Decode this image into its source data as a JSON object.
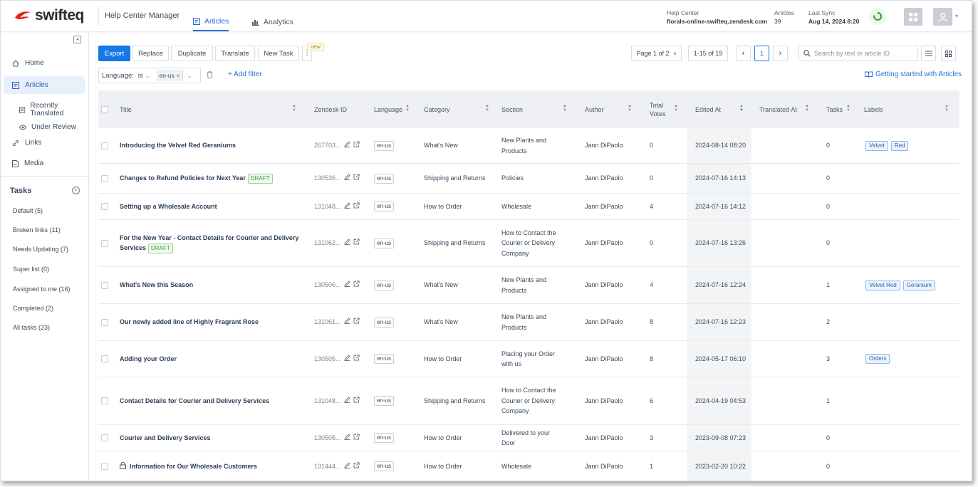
{
  "brand": {
    "name": "swifteq",
    "app_title": "Help Center Manager"
  },
  "nav": {
    "articles": "Articles",
    "analytics": "Analytics"
  },
  "header": {
    "help_center_label": "Help Center",
    "help_center_value": "florals-online-swifteq.zendesk.com",
    "articles_label": "Articles",
    "articles_value": "39",
    "sync_label": "Last Sync",
    "sync_value": "Aug 14, 2024 8:20"
  },
  "sidebar": {
    "home": "Home",
    "articles": "Articles",
    "recently_translated": "Recently Translated",
    "under_review": "Under Review",
    "links": "Links",
    "media": "Media",
    "tasks_title": "Tasks",
    "tasks": [
      "Default (5)",
      "Broken links (11)",
      "Needs Updating (7)",
      "Super list (0)",
      "Assigned to me (16)",
      "Completed (2)",
      "All tasks (23)"
    ]
  },
  "toolbar": {
    "export": "Export",
    "replace": "Replace",
    "duplicate": "Duplicate",
    "translate": "Translate",
    "new_task": "New Task",
    "new_badge": "new",
    "page_select": "Page 1 of 2",
    "range": "1-15 of 19",
    "current_page": "1",
    "search_placeholder": "Search by text or article ID"
  },
  "filter": {
    "label": "Language:",
    "operator": "is",
    "value": "en-us",
    "add_filter": "+ Add filter",
    "getting_started": "Getting started with Articles"
  },
  "columns": [
    "Title",
    "Zendesk ID",
    "Language",
    "Category",
    "Section",
    "Author",
    "Total Votes",
    "Edited At",
    "Translated At",
    "Tasks",
    "Labels"
  ],
  "rows": [
    {
      "title": "Introducing the Velvet Red Geraniums",
      "draft": "",
      "lock": false,
      "zid": "267703...",
      "lang": "en-us",
      "category": "What's New",
      "section": "New Plants and Products",
      "author": "Jann DiPaolo",
      "votes": "0",
      "edited": "2024-08-14 08:20",
      "translated": "",
      "tasks": "0",
      "labels": [
        "Velvet",
        "Red"
      ]
    },
    {
      "title": "Changes to Refund Policies for Next Year",
      "draft": "DRAFT",
      "lock": false,
      "zid": "130536...",
      "lang": "en-us",
      "category": "Shipping and Returns",
      "section": "Policies",
      "author": "Jann DiPaolo",
      "votes": "0",
      "edited": "2024-07-16 14:13",
      "translated": "",
      "tasks": "0",
      "labels": []
    },
    {
      "title": "Setting up a Wholesale Account",
      "draft": "",
      "lock": false,
      "zid": "131048...",
      "lang": "en-us",
      "category": "How to Order",
      "section": "Wholesale",
      "author": "Jann DiPaolo",
      "votes": "4",
      "edited": "2024-07-16 14:12",
      "translated": "",
      "tasks": "0",
      "labels": []
    },
    {
      "title": "For the New Year - Contact Details for Courier and Delivery Services",
      "draft": "DRAFT",
      "lock": false,
      "zid": "131062...",
      "lang": "en-us",
      "category": "Shipping and Returns",
      "section": "How to Contact the Courier or Delivery Company",
      "author": "Jann DiPaolo",
      "votes": "0",
      "edited": "2024-07-16 13:26",
      "translated": "",
      "tasks": "0",
      "labels": []
    },
    {
      "title": "What's New this Season",
      "draft": "",
      "lock": false,
      "zid": "130506...",
      "lang": "en-us",
      "category": "What's New",
      "section": "New Plants and Products",
      "author": "Jann DiPaolo",
      "votes": "4",
      "edited": "2024-07-16 12:24",
      "translated": "",
      "tasks": "1",
      "labels": [
        "Velvet Red",
        "Geranium"
      ]
    },
    {
      "title": "Our newly added line of Highly Fragrant Rose",
      "draft": "",
      "lock": false,
      "zid": "131061...",
      "lang": "en-us",
      "category": "What's New",
      "section": "New Plants and Products",
      "author": "Jann DiPaolo",
      "votes": "8",
      "edited": "2024-07-16 12:23",
      "translated": "",
      "tasks": "2",
      "labels": []
    },
    {
      "title": "Adding your Order",
      "draft": "",
      "lock": false,
      "zid": "130505...",
      "lang": "en-us",
      "category": "How to Order",
      "section": "Placing your Order with us",
      "author": "Jann DiPaolo",
      "votes": "8",
      "edited": "2024-05-17 06:10",
      "translated": "",
      "tasks": "3",
      "labels": [
        "Orders"
      ]
    },
    {
      "title": "Contact Details for Courier and Delivery Services",
      "draft": "",
      "lock": false,
      "zid": "131048...",
      "lang": "en-us",
      "category": "Shipping and Returns",
      "section": "How to Contact the Courier or Delivery Company",
      "author": "Jann DiPaolo",
      "votes": "6",
      "edited": "2024-04-19 04:53",
      "translated": "",
      "tasks": "1",
      "labels": []
    },
    {
      "title": "Courier and Delivery Services",
      "draft": "",
      "lock": false,
      "zid": "130505...",
      "lang": "en-us",
      "category": "How to Order",
      "section": "Delivered to your Door",
      "author": "Jann DiPaolo",
      "votes": "3",
      "edited": "2023-09-08 07:23",
      "translated": "",
      "tasks": "0",
      "labels": []
    },
    {
      "title": "Information for Our Wholesale Customers",
      "draft": "",
      "lock": true,
      "zid": "131444...",
      "lang": "en-us",
      "category": "How to Order",
      "section": "Wholesale",
      "author": "Jann DiPaolo",
      "votes": "1",
      "edited": "2023-02-20 10:22",
      "translated": "",
      "tasks": "0",
      "labels": []
    }
  ],
  "colors": {
    "accent": "#1677e6",
    "draft": "#3e9a3e",
    "sidebar_active": "#e8f0fb"
  }
}
